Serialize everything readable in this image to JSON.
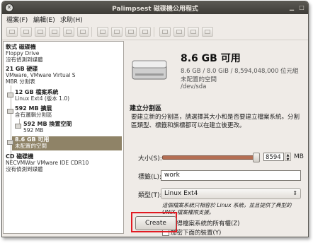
{
  "window": {
    "title": "Palimpsest 磁碟機公用程式"
  },
  "menus": [
    "檔案(F)",
    "編輯(E)",
    "求助(H)"
  ],
  "tree": {
    "nodes": [
      {
        "title": "軟式 磁碟機",
        "sub": [
          "Floppy Drive",
          "沒有偵測到媒體"
        ]
      },
      {
        "title": "21 GB 硬碟",
        "sub": [
          "VMware, VMware Virtual S",
          "MBR 分割表"
        ]
      },
      {
        "title": "12 GB 檔案系統",
        "sub": [
          "Linux Ext4 (版本 1.0)"
        ]
      },
      {
        "title": "592 MB 擴展",
        "sub": [
          "含有邏輯分割區"
        ]
      },
      {
        "title": "592 MB 換置空間",
        "sub": [
          "592 MB"
        ]
      },
      {
        "title": "8.6 GB 可用",
        "sub": [
          "未配置的空間"
        ]
      },
      {
        "title": "CD 磁碟機",
        "sub": [
          "NECVMWar VMware IDE CDR10",
          "沒有偵測到媒體"
        ]
      }
    ]
  },
  "device": {
    "title": "8.6 GB 可用",
    "line1": "8.6 GB / 8.0 GiB / 8,594,048,000 位元組",
    "line2": "未配置的空間",
    "line3": "/dev/sda"
  },
  "create_partition": {
    "section_title": "建立分割區",
    "description": "要建立新的分割區，請選擇其大小和是否要建立檔案系統。分割區類型、標籤和旗標都可以在建立後更改。",
    "size_label": "大小(S):",
    "size_value": "8594",
    "size_unit": "MB",
    "size_fraction": 1.0,
    "label_label": "標籤(L):",
    "label_value": "work",
    "type_label": "類型(T):",
    "type_value": "Linux Ext4",
    "hint": "這個檔案系統只相容於 Linux 系統，並且提供了典型的 UNIX 檔案權限支援。",
    "check_owner_label": "取得檔案系統的所有權(Z)",
    "check_owner_checked": true,
    "check_encrypt_label": "加密下面的裝置(Y)",
    "check_encrypt_checked": false,
    "create_label": "Create"
  },
  "colors": {
    "highlight_box": "#e21a22",
    "selection": "#8f8367",
    "titlebar": "#4a4844"
  }
}
